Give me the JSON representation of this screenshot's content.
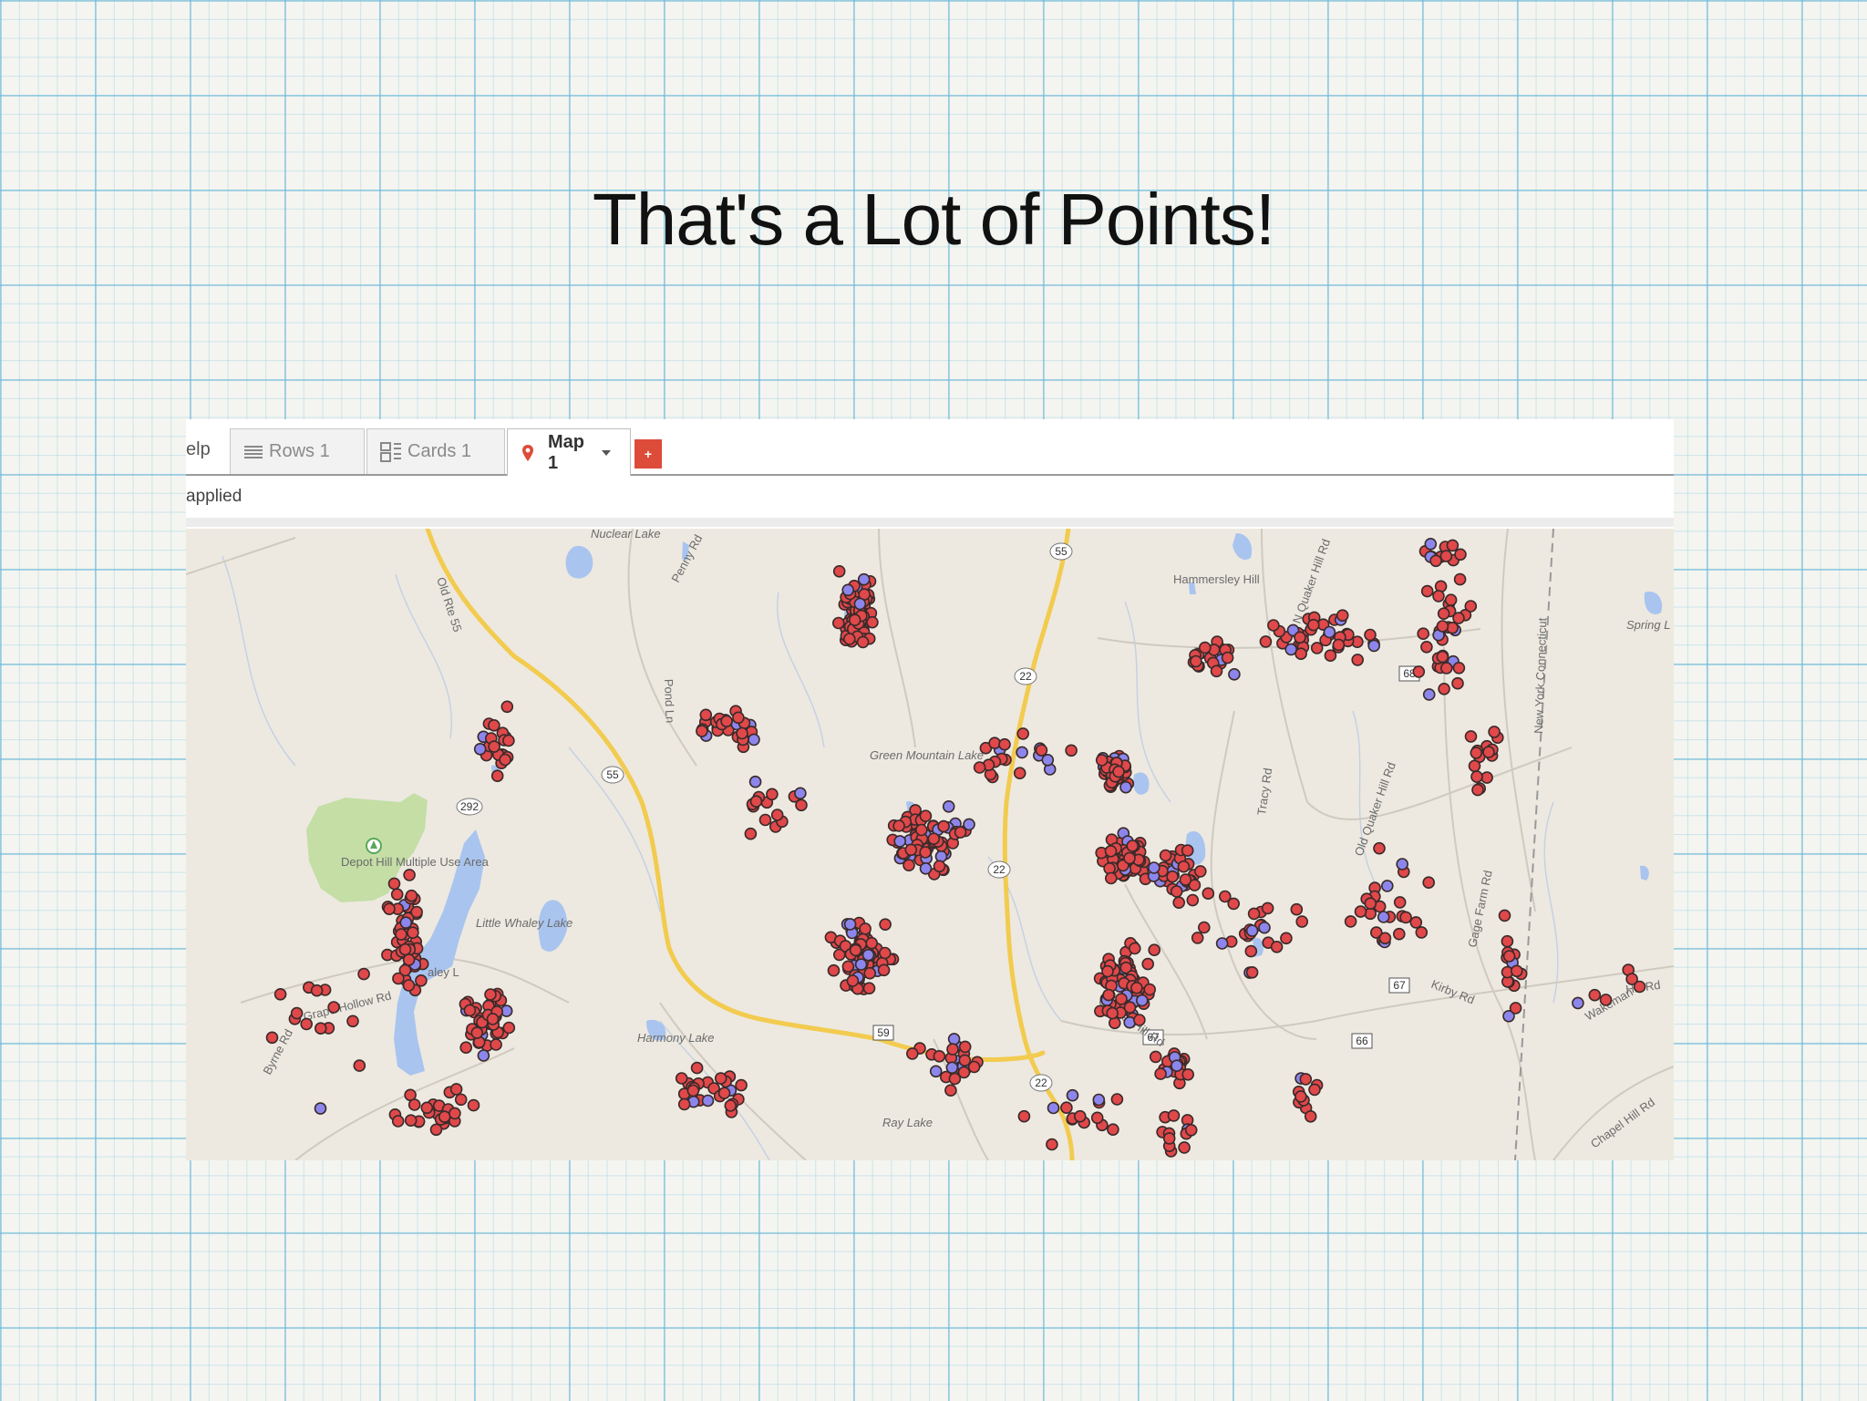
{
  "slide": {
    "title": "That's a Lot of Points!"
  },
  "tabs": {
    "help_partial": "elp",
    "rows": "Rows 1",
    "cards": "Cards 1",
    "map": "Map 1",
    "add": "+"
  },
  "filter": {
    "status": "applied"
  },
  "map_labels": {
    "nuclear_lake": "Nuclear Lake",
    "hammersley_hill": "Hammersley Hill",
    "green_mountain_lake": "Green Mountain Lake",
    "depot_hill": "Depot Hill Multiple Use Area",
    "little_whaley_lake": "Little Whaley Lake",
    "whaley_lake": "aley L",
    "harmony_lake": "Harmony Lake",
    "ray_lake": "Ray Lake",
    "spring_lake": "Spring L",
    "ny_ct": "New York Connecticut",
    "old_rte_55": "Old Rte 55",
    "penny_rd": "Penny Rd",
    "pond_ln": "Pond Ln",
    "tracy_rd": "Tracy Rd",
    "old_quaker_hill_rd": "Old Quaker Hill Rd",
    "n_quaker_hill_rd": "N Quaker Hill Rd",
    "grape_hollow_rd": "Grape Hollow Rd",
    "byrne_rd": "Byrne Rd",
    "chapel_hill_rd": "Chapel Hill Rd",
    "kirby_rd": "Kirby Rd",
    "gage_farm_rd": "Gage Farm Rd",
    "quaker_hill_rd": "Quaker Hill Rd",
    "chestnut_ridge_rd": "Hill Rd",
    "wakeman_rd": "Wakeman",
    "route_55": "55",
    "route_22": "22",
    "route_292": "292",
    "route_68": "68",
    "route_66": "66",
    "route_67": "67",
    "route_59": "59"
  },
  "colors": {
    "marker_red": "#e0484a",
    "marker_blue": "#8c86ec",
    "marker_stroke": "#3a2a2a",
    "water": "#a9c4ef",
    "park": "#c4dea6",
    "highway": "#f2cb4f",
    "map_bg": "#ede9e0",
    "add_button": "#dd4b39"
  },
  "icons": {
    "rows": "list-icon",
    "cards": "cards-icon",
    "map": "map-pin-icon",
    "dropdown": "caret-down-icon",
    "park": "park-marker-icon"
  }
}
